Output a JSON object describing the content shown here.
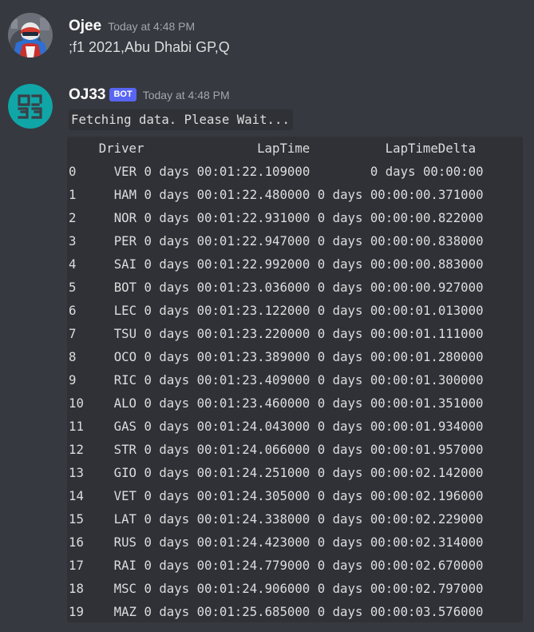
{
  "messages": [
    {
      "username": "Ojee",
      "timestamp": "Today at 4:48 PM",
      "content": ";f1 2021,Abu Dhabi GP,Q",
      "avatar_icon": "racing-driver-avatar-icon"
    },
    {
      "username": "OJ33",
      "badge": "BOT",
      "timestamp": "Today at 4:48 PM",
      "status": "Fetching data. Please Wait...",
      "avatar_icon": "oj33-logo-avatar-icon",
      "table": {
        "header_line": "    Driver               LapTime          LapTimeDelta",
        "columns": [
          "Driver",
          "LapTime",
          "LapTimeDelta"
        ],
        "rows": [
          {
            "index": "0",
            "driver": "VER",
            "lap_time": "0 days 00:01:22.109000",
            "delta": "0 days 00:00:00"
          },
          {
            "index": "1",
            "driver": "HAM",
            "lap_time": "0 days 00:01:22.480000",
            "delta": "0 days 00:00:00.371000"
          },
          {
            "index": "2",
            "driver": "NOR",
            "lap_time": "0 days 00:01:22.931000",
            "delta": "0 days 00:00:00.822000"
          },
          {
            "index": "3",
            "driver": "PER",
            "lap_time": "0 days 00:01:22.947000",
            "delta": "0 days 00:00:00.838000"
          },
          {
            "index": "4",
            "driver": "SAI",
            "lap_time": "0 days 00:01:22.992000",
            "delta": "0 days 00:00:00.883000"
          },
          {
            "index": "5",
            "driver": "BOT",
            "lap_time": "0 days 00:01:23.036000",
            "delta": "0 days 00:00:00.927000"
          },
          {
            "index": "6",
            "driver": "LEC",
            "lap_time": "0 days 00:01:23.122000",
            "delta": "0 days 00:00:01.013000"
          },
          {
            "index": "7",
            "driver": "TSU",
            "lap_time": "0 days 00:01:23.220000",
            "delta": "0 days 00:00:01.111000"
          },
          {
            "index": "8",
            "driver": "OCO",
            "lap_time": "0 days 00:01:23.389000",
            "delta": "0 days 00:00:01.280000"
          },
          {
            "index": "9",
            "driver": "RIC",
            "lap_time": "0 days 00:01:23.409000",
            "delta": "0 days 00:00:01.300000"
          },
          {
            "index": "10",
            "driver": "ALO",
            "lap_time": "0 days 00:01:23.460000",
            "delta": "0 days 00:00:01.351000"
          },
          {
            "index": "11",
            "driver": "GAS",
            "lap_time": "0 days 00:01:24.043000",
            "delta": "0 days 00:00:01.934000"
          },
          {
            "index": "12",
            "driver": "STR",
            "lap_time": "0 days 00:01:24.066000",
            "delta": "0 days 00:00:01.957000"
          },
          {
            "index": "13",
            "driver": "GIO",
            "lap_time": "0 days 00:01:24.251000",
            "delta": "0 days 00:00:02.142000"
          },
          {
            "index": "14",
            "driver": "VET",
            "lap_time": "0 days 00:01:24.305000",
            "delta": "0 days 00:00:02.196000"
          },
          {
            "index": "15",
            "driver": "LAT",
            "lap_time": "0 days 00:01:24.338000",
            "delta": "0 days 00:00:02.229000"
          },
          {
            "index": "16",
            "driver": "RUS",
            "lap_time": "0 days 00:01:24.423000",
            "delta": "0 days 00:00:02.314000"
          },
          {
            "index": "17",
            "driver": "RAI",
            "lap_time": "0 days 00:01:24.779000",
            "delta": "0 days 00:00:02.670000"
          },
          {
            "index": "18",
            "driver": "MSC",
            "lap_time": "0 days 00:01:24.906000",
            "delta": "0 days 00:00:02.797000"
          },
          {
            "index": "19",
            "driver": "MAZ",
            "lap_time": "0 days 00:01:25.685000",
            "delta": "0 days 00:00:03.576000"
          }
        ]
      }
    }
  ],
  "colors": {
    "background": "#36393f",
    "code_background": "#2f3136",
    "username": "#ffffff",
    "timestamp": "#a3a6aa",
    "text": "#dcddde",
    "bot_badge": "#5865f2",
    "bot_avatar": "#10a6a8"
  }
}
